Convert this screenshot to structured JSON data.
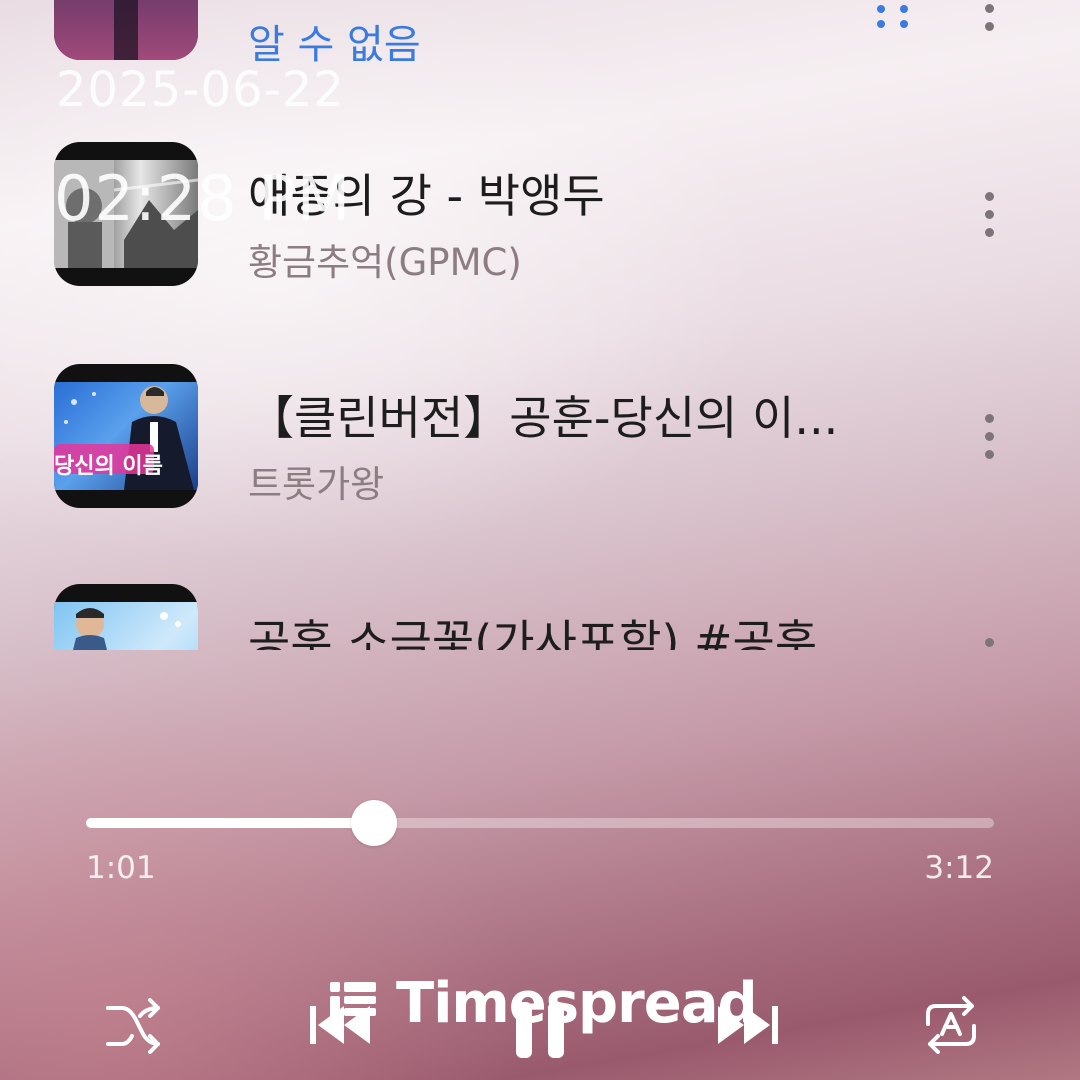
{
  "playlist": {
    "items": [
      {
        "title": "",
        "subtitle": "알 수 없음",
        "subtitle_color": "#3b7be0"
      },
      {
        "title": "애증의 강 - 박앵두",
        "subtitle": "황금추억(GPMC)"
      },
      {
        "title": "【클린버전】공훈-당신의 이...",
        "subtitle": "트롯가왕",
        "thumb_caption": "당신의 이름"
      },
      {
        "title": "공훈 소금꽃(가사포함) #공훈...",
        "subtitle": ""
      }
    ]
  },
  "watermark": {
    "date": "2025-06-22",
    "time": "02:28 PM"
  },
  "player": {
    "elapsed": "1:01",
    "duration": "3:12",
    "progress_fraction": 0.317
  },
  "controls": {
    "shuffle_icon": "shuffle-icon",
    "previous_icon": "skip-previous-icon",
    "pause_icon": "pause-icon",
    "next_icon": "skip-next-icon",
    "repeat_icon": "repeat-all-icon"
  },
  "brand": {
    "name": "Timespread"
  },
  "colors": {
    "accent": "#3b7be0",
    "progress": "#ffffff"
  }
}
